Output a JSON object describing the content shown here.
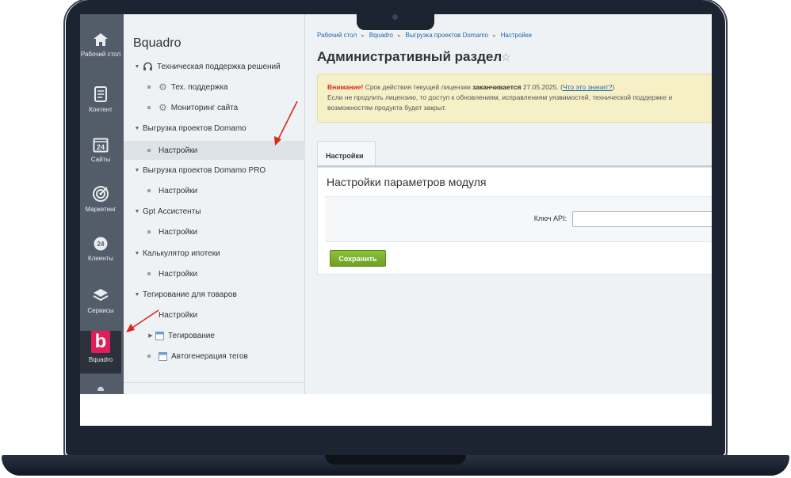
{
  "sidebar_left": {
    "items": [
      {
        "label": "Рабочий стол",
        "icon": "home-icon"
      },
      {
        "label": "Контент",
        "icon": "document-icon"
      },
      {
        "label": "Сайты",
        "icon": "calendar-24-icon"
      },
      {
        "label": "Маркетинг",
        "icon": "target-icon"
      },
      {
        "label": "Клиенты",
        "icon": "clients-24-icon"
      },
      {
        "label": "Сервисы",
        "icon": "layers-icon"
      },
      {
        "label": "Bquadro",
        "icon": "bquadro-logo-icon",
        "logo_letter": "b"
      }
    ]
  },
  "menu": {
    "title": "Bquadro",
    "items": [
      {
        "label": "Техническая поддержка решений"
      },
      {
        "label": "Тех. поддержка"
      },
      {
        "label": "Мониторинг сайта"
      },
      {
        "label": "Выгрузка проектов Domamo"
      },
      {
        "label": "Настройки"
      },
      {
        "label": "Выгрузка проектов Domamo PRO"
      },
      {
        "label": "Настройки"
      },
      {
        "label": "Gpt Ассистенты"
      },
      {
        "label": "Настройки"
      },
      {
        "label": "Калькулятор ипотеки"
      },
      {
        "label": "Настройки"
      },
      {
        "label": "Тегирование для товаров"
      },
      {
        "label": "Настройки"
      },
      {
        "label": "Тегирование"
      },
      {
        "label": "Автогенерация тегов"
      }
    ]
  },
  "breadcrumbs": [
    "Рабочий стол",
    "Bquadro",
    "Выгрузка проектов Domamo",
    "Настройки"
  ],
  "page_title": "Административный раздел",
  "warning": {
    "prefix": "Внимание!",
    "text1": " Срок действия текущей лицензии ",
    "bold": "заканчивается",
    "text2": " 27.05.2025. (",
    "link": "Что это значит?",
    "text3": ")",
    "line2": "Если не продлить лицензию, то доступ к обновлениям, исправлениям уязвимостей, технической поддержке и",
    "line3": "возможностям продукта будет закрыт."
  },
  "tab_label": "Настройки",
  "panel_title": "Настройки параметров модуля",
  "field": {
    "label": "Ключ API:",
    "value": ""
  },
  "save_label": "Сохранить",
  "colors": {
    "accent_green": "#7cb32e",
    "warning_bg": "#f6f0c7",
    "warning_red": "#d9261c",
    "link": "#2067b0",
    "brand": "#e01e5a"
  }
}
